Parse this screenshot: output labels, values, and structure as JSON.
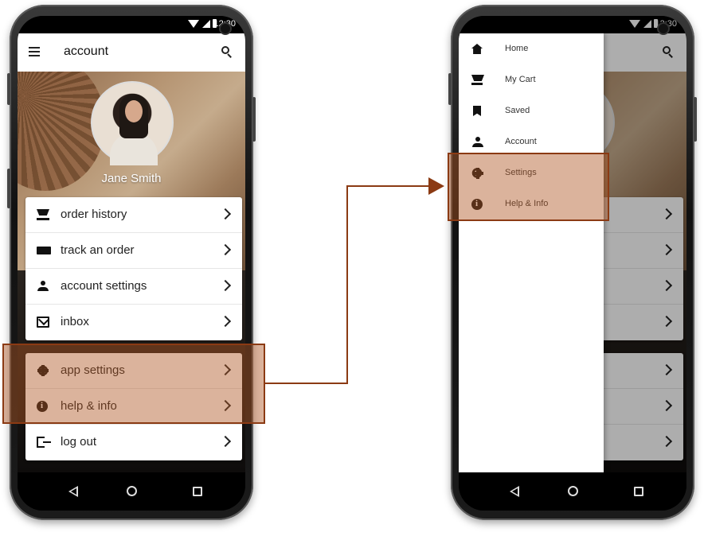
{
  "status_time": "12:30",
  "left_phone": {
    "appbar_title": "account",
    "profile_name": "Jane Smith",
    "menu_primary": [
      {
        "label": "order history",
        "icon": "cart-icon"
      },
      {
        "label": "track an order",
        "icon": "truck-icon"
      },
      {
        "label": "account settings",
        "icon": "person-icon"
      },
      {
        "label": "inbox",
        "icon": "mail-icon"
      }
    ],
    "menu_secondary": [
      {
        "label": "app settings",
        "icon": "gear-icon"
      },
      {
        "label": "help & info",
        "icon": "info-icon"
      },
      {
        "label": "log out",
        "icon": "logout-icon"
      }
    ]
  },
  "right_phone": {
    "drawer_items": [
      {
        "label": "Home",
        "icon": "home-icon"
      },
      {
        "label": "My Cart",
        "icon": "cart-icon"
      },
      {
        "label": "Saved",
        "icon": "bookmark-icon"
      },
      {
        "label": "Account",
        "icon": "person-icon"
      },
      {
        "label": "Settings",
        "icon": "gear-icon"
      },
      {
        "label": "Help & Info",
        "icon": "info-icon"
      }
    ]
  },
  "colors": {
    "highlight_fill": "#b05623",
    "highlight_stroke": "#8b3a13"
  }
}
